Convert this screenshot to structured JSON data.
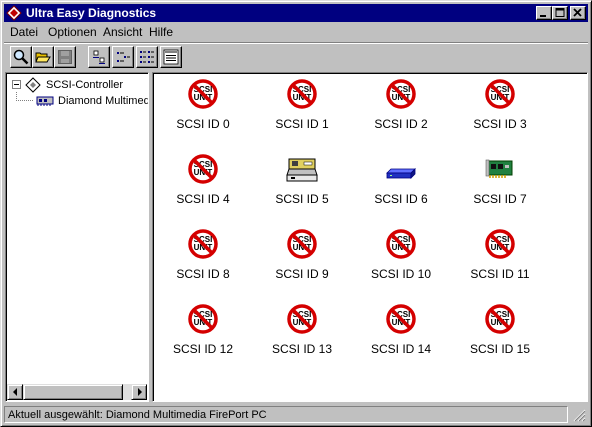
{
  "window": {
    "title": "Ultra Easy Diagnostics",
    "controls": [
      "minimize-icon",
      "maximize-icon",
      "close-icon"
    ]
  },
  "menu": [
    "Datei",
    "Optionen",
    "Ansicht",
    "Hilfe"
  ],
  "toolbar": [
    "search-icon",
    "open-folder-icon",
    "save-icon",
    "large-icons-view-icon",
    "small-icons-view-icon",
    "list-view-icon",
    "details-view-icon"
  ],
  "tree": {
    "root": "SCSI-Controller",
    "child": "Diamond Multimedia FirePort PC"
  },
  "devices": [
    {
      "label": "SCSI ID 0",
      "icon": "no-scsi-unit-icon"
    },
    {
      "label": "SCSI ID 1",
      "icon": "no-scsi-unit-icon"
    },
    {
      "label": "SCSI ID 2",
      "icon": "no-scsi-unit-icon"
    },
    {
      "label": "SCSI ID 3",
      "icon": "no-scsi-unit-icon"
    },
    {
      "label": "SCSI ID 4",
      "icon": "no-scsi-unit-icon"
    },
    {
      "label": "SCSI ID 5",
      "icon": "scanner-icon"
    },
    {
      "label": "SCSI ID 6",
      "icon": "hard-drive-icon"
    },
    {
      "label": "SCSI ID 7",
      "icon": "controller-card-icon"
    },
    {
      "label": "SCSI ID 8",
      "icon": "no-scsi-unit-icon"
    },
    {
      "label": "SCSI ID 9",
      "icon": "no-scsi-unit-icon"
    },
    {
      "label": "SCSI ID 10",
      "icon": "no-scsi-unit-icon"
    },
    {
      "label": "SCSI ID 11",
      "icon": "no-scsi-unit-icon"
    },
    {
      "label": "SCSI ID 12",
      "icon": "no-scsi-unit-icon"
    },
    {
      "label": "SCSI ID 13",
      "icon": "no-scsi-unit-icon"
    },
    {
      "label": "SCSI ID 14",
      "icon": "no-scsi-unit-icon"
    },
    {
      "label": "SCSI ID 15",
      "icon": "no-scsi-unit-icon"
    }
  ],
  "no_unit_icon_text": [
    "SCSI",
    "UNIT"
  ],
  "status": "Aktuell ausgewählt:  Diamond Multimedia FirePort PC",
  "colors": {
    "titlebar": "#000080",
    "prohibit": "#d40000",
    "window": "#c0c0c0"
  }
}
